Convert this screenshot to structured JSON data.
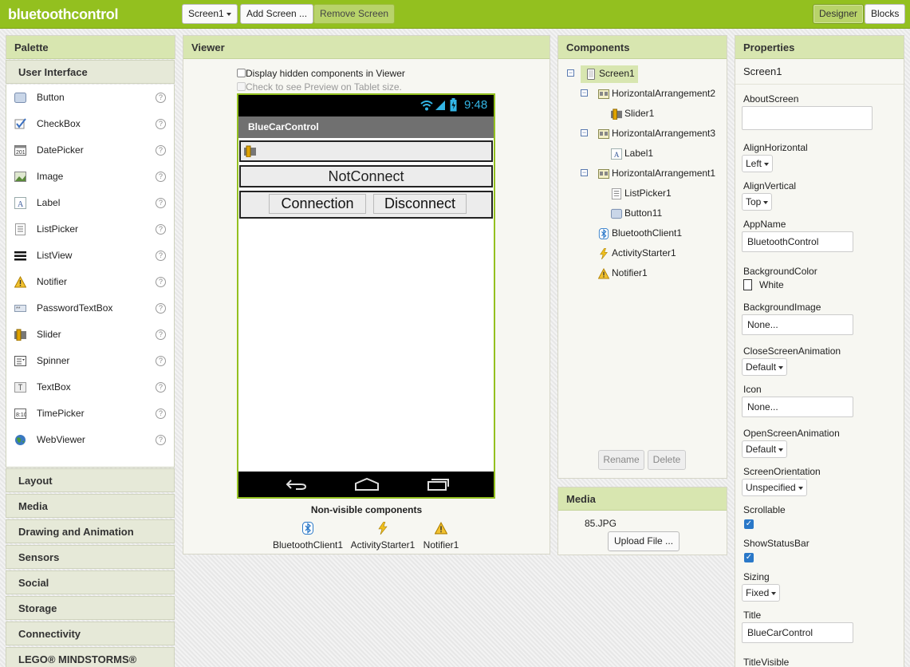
{
  "app": {
    "title": "bluetoothcontrol"
  },
  "toolbar": {
    "screen_select": "Screen1",
    "add_screen": "Add Screen ...",
    "remove_screen": "Remove Screen",
    "designer": "Designer",
    "blocks": "Blocks"
  },
  "palette": {
    "title": "Palette",
    "open_category": "User Interface",
    "items": [
      {
        "label": "Button",
        "icon": "button-icon"
      },
      {
        "label": "CheckBox",
        "icon": "checkbox-icon"
      },
      {
        "label": "DatePicker",
        "icon": "datepicker-icon"
      },
      {
        "label": "Image",
        "icon": "image-icon"
      },
      {
        "label": "Label",
        "icon": "label-icon"
      },
      {
        "label": "ListPicker",
        "icon": "listpicker-icon"
      },
      {
        "label": "ListView",
        "icon": "listview-icon"
      },
      {
        "label": "Notifier",
        "icon": "notifier-icon"
      },
      {
        "label": "PasswordTextBox",
        "icon": "password-icon"
      },
      {
        "label": "Slider",
        "icon": "slider-icon"
      },
      {
        "label": "Spinner",
        "icon": "spinner-icon"
      },
      {
        "label": "TextBox",
        "icon": "textbox-icon"
      },
      {
        "label": "TimePicker",
        "icon": "timepicker-icon"
      },
      {
        "label": "WebViewer",
        "icon": "webviewer-icon"
      }
    ],
    "help_glyph": "?",
    "categories": [
      "Layout",
      "Media",
      "Drawing and Animation",
      "Sensors",
      "Social",
      "Storage",
      "Connectivity",
      "LEGO® MINDSTORMS®"
    ]
  },
  "viewer": {
    "title": "Viewer",
    "hidden_checkbox_label": "Display hidden components in Viewer",
    "tablet_checkbox_label": "Check to see Preview on Tablet size.",
    "phone": {
      "time": "9:48",
      "screen_title": "BlueCarControl",
      "notconnect_label": "NotConnect",
      "connection_button": "Connection",
      "disconnect_button": "Disconnect"
    },
    "nonvisible_title": "Non-visible components",
    "nonvisible": [
      "BluetoothClient1",
      "ActivityStarter1",
      "Notifier1"
    ]
  },
  "components": {
    "title": "Components",
    "tree": {
      "screen": "Screen1",
      "harr2": "HorizontalArrangement2",
      "slider": "Slider1",
      "harr3": "HorizontalArrangement3",
      "label": "Label1",
      "harr1": "HorizontalArrangement1",
      "listpicker": "ListPicker1",
      "button": "Button11",
      "bluetooth": "BluetoothClient1",
      "activity": "ActivityStarter1",
      "notifier": "Notifier1"
    },
    "toggle_glyph": "−",
    "rename": "Rename",
    "delete": "Delete"
  },
  "media": {
    "title": "Media",
    "file": "85.JPG",
    "upload": "Upload File ..."
  },
  "properties": {
    "title": "Properties",
    "component": "Screen1",
    "about_screen": {
      "label": "AboutScreen",
      "value": ""
    },
    "align_horizontal": {
      "label": "AlignHorizontal",
      "value": "Left"
    },
    "align_vertical": {
      "label": "AlignVertical",
      "value": "Top"
    },
    "app_name": {
      "label": "AppName",
      "value": "BluetoothControl"
    },
    "background_color": {
      "label": "BackgroundColor",
      "value": "White",
      "swatch": "#ffffff"
    },
    "background_image": {
      "label": "BackgroundImage",
      "value": "None..."
    },
    "close_anim": {
      "label": "CloseScreenAnimation",
      "value": "Default"
    },
    "icon": {
      "label": "Icon",
      "value": "None..."
    },
    "open_anim": {
      "label": "OpenScreenAnimation",
      "value": "Default"
    },
    "orientation": {
      "label": "ScreenOrientation",
      "value": "Unspecified"
    },
    "scrollable": {
      "label": "Scrollable",
      "checked": true
    },
    "show_status": {
      "label": "ShowStatusBar",
      "checked": true
    },
    "check_glyph": "✓",
    "sizing": {
      "label": "Sizing",
      "value": "Fixed"
    },
    "title_prop": {
      "label": "Title",
      "value": "BlueCarControl"
    },
    "title_visible": {
      "label": "TitleVisible"
    }
  },
  "colors": {
    "accent": "#93c01f",
    "header": "#d8e6b0",
    "check": "#2a78c8"
  }
}
